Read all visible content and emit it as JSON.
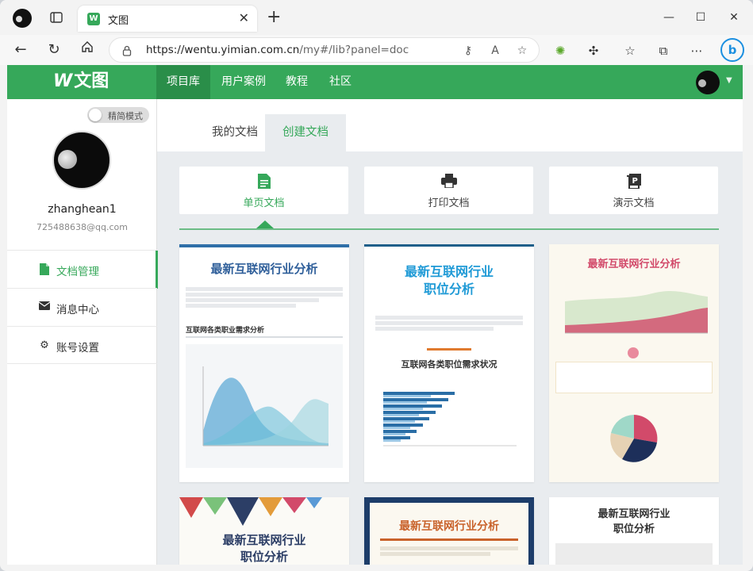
{
  "browser": {
    "tab_title": "文图",
    "tab_favicon": "W",
    "new_tab_symbol": "+",
    "url_host": "https://wentu.yimian.com.cn",
    "url_path": "/my#/lib?panel=doc",
    "icons": [
      "tab-actions-icon",
      "back-icon",
      "refresh-icon",
      "home-icon",
      "lock-icon",
      "key-icon",
      "read-aloud-icon",
      "favorite-add-icon",
      "extension-icon",
      "extensions-icon",
      "favorites-icon",
      "collections-icon",
      "more-icon",
      "bing-icon",
      "minimize-icon",
      "maximize-icon",
      "close-icon"
    ]
  },
  "site": {
    "logo_mark": "W",
    "logo_text": "文图",
    "nav": [
      {
        "label": "项目库",
        "active": true
      },
      {
        "label": "用户案例",
        "active": false
      },
      {
        "label": "教程",
        "active": false
      },
      {
        "label": "社区",
        "active": false
      }
    ]
  },
  "sidebar": {
    "mode_label": "精简模式",
    "username": "zhanghean1",
    "email": "725488638@qq.com",
    "menu": [
      {
        "label": "文档管理",
        "icon": "document-icon",
        "active": true
      },
      {
        "label": "消息中心",
        "icon": "envelope-icon",
        "active": false
      },
      {
        "label": "账号设置",
        "icon": "gear-icon",
        "active": false
      }
    ]
  },
  "content": {
    "tabs": [
      {
        "label": "我的文档",
        "active": false
      },
      {
        "label": "创建文档",
        "active": true
      }
    ],
    "doc_types": [
      {
        "label": "单页文档",
        "icon": "single-page-doc-icon",
        "active": true
      },
      {
        "label": "打印文档",
        "icon": "printer-icon",
        "active": false
      },
      {
        "label": "演示文档",
        "icon": "presentation-icon",
        "active": false
      }
    ],
    "templates": [
      {
        "title": "最新互联网行业分析",
        "subtitle": "互联网各类职业需求分析",
        "accent": "#2f6fa8"
      },
      {
        "title": "最新互联网行业\n职位分析",
        "subtitle": "互联网各类职位需求状况",
        "accent": "#1f9ad6"
      },
      {
        "title": "最新互联网行业分析",
        "subtitle": "",
        "accent": "#d24a6a"
      },
      {
        "title": "最新互联网行业\n职位分析",
        "subtitle": "",
        "accent": "#2c3e66"
      },
      {
        "title": "最新互联网行业分析",
        "subtitle": "",
        "accent": "#c9622b"
      },
      {
        "title": "最新互联网行业\n职位分析",
        "subtitle": "",
        "accent": "#333333"
      }
    ]
  },
  "colors": {
    "brand_green": "#36a85a",
    "brand_green_dark": "#2a8e49"
  }
}
